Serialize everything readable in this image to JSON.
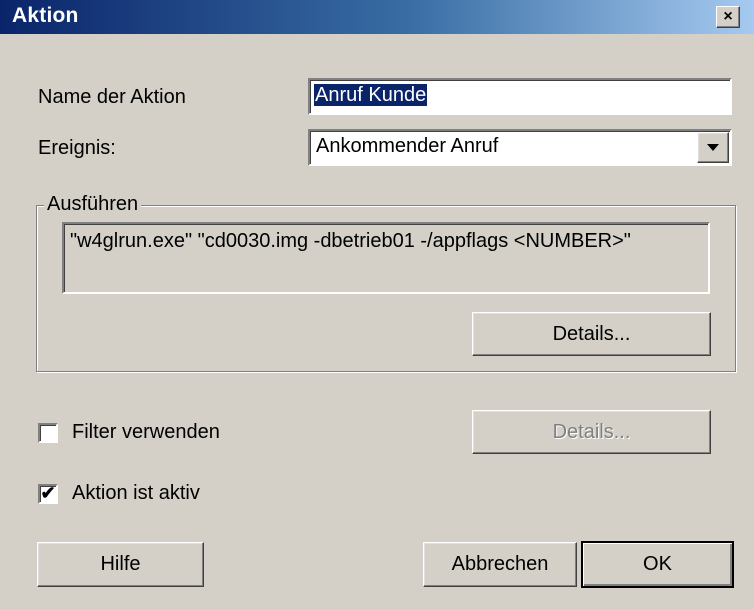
{
  "window": {
    "title": "Aktion",
    "close_label": "×"
  },
  "name": {
    "label": "Name der Aktion",
    "value": "Anruf Kunde"
  },
  "event": {
    "label": "Ereignis:",
    "selected": "Ankommender Anruf"
  },
  "execute": {
    "legend": "Ausführen",
    "command": "\"w4glrun.exe\" \"cd0030.img -dbetrieb01 -/appflags <NUMBER>\"",
    "details_label": "Details..."
  },
  "filter": {
    "label": "Filter verwenden",
    "checked": false,
    "details_label": "Details..."
  },
  "active": {
    "label": "Aktion ist aktiv",
    "checked": true,
    "mark": "✔"
  },
  "buttons": {
    "help": "Hilfe",
    "cancel": "Abbrechen",
    "ok": "OK"
  }
}
